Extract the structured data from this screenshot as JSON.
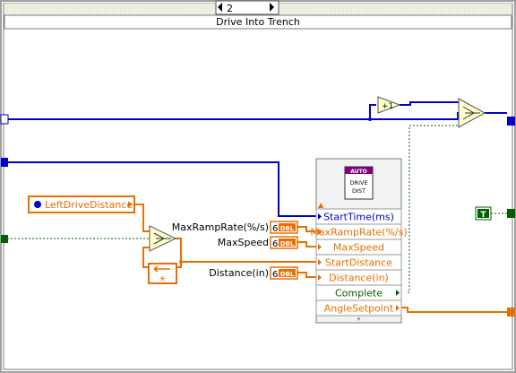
{
  "case_structure": {
    "selector_value": "2",
    "frame_label": "Drive Into Trench"
  },
  "drive_dist_vi": {
    "header": "AUTO",
    "icon_lines": [
      "DRIVE",
      "DIST"
    ],
    "terminals": [
      {
        "name": "StartTime(ms)",
        "color": "#0000cc"
      },
      {
        "name": "MaxRampRate(%/s)",
        "color": "#e96f00"
      },
      {
        "name": "MaxSpeed",
        "color": "#e96f00"
      },
      {
        "name": "StartDistance",
        "color": "#e96f00"
      },
      {
        "name": "Distance(in)",
        "color": "#e96f00"
      },
      {
        "name": "Complete",
        "color": "#006000"
      },
      {
        "name": "AngleSetpoint",
        "color": "#e96f00"
      }
    ]
  },
  "local_variable": {
    "label": "LeftDriveDistance"
  },
  "constants": {
    "max_ramp_rate_label": "MaxRampRate(%/s)",
    "max_speed_label": "MaxSpeed",
    "distance_label": "Distance(in)",
    "numeric_prefix": "6",
    "numeric_type": "DBL",
    "true_constant": "T"
  },
  "increment_node": {
    "label": "+1"
  },
  "colors": {
    "integer_wire": "#0000cc",
    "double_wire": "#e96f00",
    "boolean_wire": "#006000",
    "structure_border": "#808080",
    "node_fill": "#ffffcc"
  }
}
